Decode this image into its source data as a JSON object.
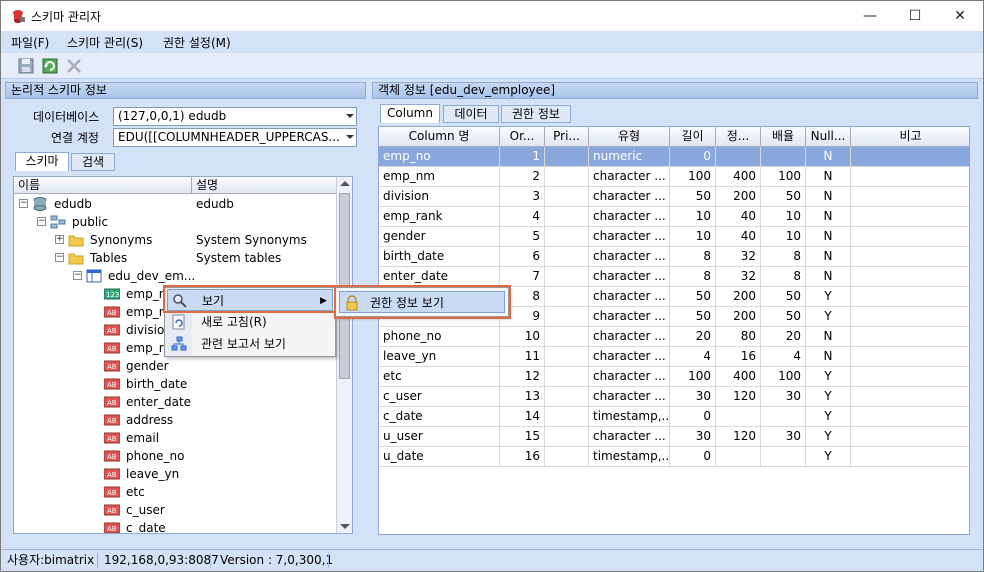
{
  "window": {
    "title": "스키마 관리자",
    "minimize": "—",
    "maximize": "☐",
    "close": "✕"
  },
  "menu": [
    "파일(F)",
    "스키마 관리(S)",
    "권한 설정(M)"
  ],
  "left_panel": {
    "title": "논리적 스키마 정보",
    "db_label": "데이터베이스",
    "db_value": "(127,0,0,1) edudb",
    "conn_label": "연결 계정",
    "conn_value": "EDU([[COLUMNHEADER_UPPERCAS...",
    "tabs": [
      "스키마",
      "검색"
    ],
    "tree_headers": [
      "이름",
      "설명"
    ],
    "tree": [
      {
        "name": "edudb",
        "desc": "edudb"
      },
      {
        "name": "public",
        "desc": ""
      },
      {
        "name": "Synonyms",
        "desc": "System Synonyms"
      },
      {
        "name": "Tables",
        "desc": "System tables"
      },
      {
        "name": "edu_dev_em...",
        "desc": ""
      },
      {
        "name": "emp_n",
        "desc": ""
      },
      {
        "name": "emp_r",
        "desc": ""
      },
      {
        "name": "division",
        "desc": ""
      },
      {
        "name": "emp_ra",
        "desc": ""
      },
      {
        "name": "gender",
        "desc": ""
      },
      {
        "name": "birth_date",
        "desc": ""
      },
      {
        "name": "enter_date",
        "desc": ""
      },
      {
        "name": "address",
        "desc": ""
      },
      {
        "name": "email",
        "desc": ""
      },
      {
        "name": "phone_no",
        "desc": ""
      },
      {
        "name": "leave_yn",
        "desc": ""
      },
      {
        "name": "etc",
        "desc": ""
      },
      {
        "name": "c_user",
        "desc": ""
      },
      {
        "name": "c_date",
        "desc": ""
      }
    ]
  },
  "right_panel": {
    "title": "객체 정보  [edu_dev_employee]",
    "tabs": [
      "Column",
      "데이터",
      "권한 정보"
    ],
    "headers": [
      "Column 명",
      "Or...",
      "Pri...",
      "유형",
      "길이",
      "정...",
      "배율",
      "Null...",
      "비고"
    ],
    "rows": [
      [
        "emp_no",
        "1",
        "",
        "numeric",
        "0",
        "",
        "",
        "N",
        ""
      ],
      [
        "emp_nm",
        "2",
        "",
        "character ...",
        "100",
        "400",
        "100",
        "N",
        ""
      ],
      [
        "division",
        "3",
        "",
        "character ...",
        "50",
        "200",
        "50",
        "N",
        ""
      ],
      [
        "emp_rank",
        "4",
        "",
        "character ...",
        "10",
        "40",
        "10",
        "N",
        ""
      ],
      [
        "gender",
        "5",
        "",
        "character ...",
        "10",
        "40",
        "10",
        "N",
        ""
      ],
      [
        "birth_date",
        "6",
        "",
        "character ...",
        "8",
        "32",
        "8",
        "N",
        ""
      ],
      [
        "enter_date",
        "7",
        "",
        "character ...",
        "8",
        "32",
        "8",
        "N",
        ""
      ],
      [
        "",
        "8",
        "",
        "character ...",
        "50",
        "200",
        "50",
        "Y",
        ""
      ],
      [
        "",
        "9",
        "",
        "character ...",
        "50",
        "200",
        "50",
        "Y",
        ""
      ],
      [
        "phone_no",
        "10",
        "",
        "character ...",
        "20",
        "80",
        "20",
        "N",
        ""
      ],
      [
        "leave_yn",
        "11",
        "",
        "character ...",
        "4",
        "16",
        "4",
        "N",
        ""
      ],
      [
        "etc",
        "12",
        "",
        "character ...",
        "100",
        "400",
        "100",
        "Y",
        ""
      ],
      [
        "c_user",
        "13",
        "",
        "character ...",
        "30",
        "120",
        "30",
        "Y",
        ""
      ],
      [
        "c_date",
        "14",
        "",
        "timestamp,...",
        "0",
        "",
        "",
        "Y",
        ""
      ],
      [
        "u_user",
        "15",
        "",
        "character ...",
        "30",
        "120",
        "30",
        "Y",
        ""
      ],
      [
        "u_date",
        "16",
        "",
        "timestamp,...",
        "0",
        "",
        "",
        "Y",
        ""
      ]
    ]
  },
  "context_menu": {
    "items": [
      "보기",
      "새로 고침(R)",
      "관련 보고서 보기"
    ],
    "submenu": [
      "권한 정보 보기"
    ]
  },
  "status": {
    "user": "사용자:bimatrix",
    "address": "192,168,0,93:8087",
    "version": "Version : 7,0,300,1"
  },
  "colors": {
    "selection": "#8aa7dd",
    "highlight_border": "#e06a45",
    "panel_bg": "#d4e2f7"
  }
}
